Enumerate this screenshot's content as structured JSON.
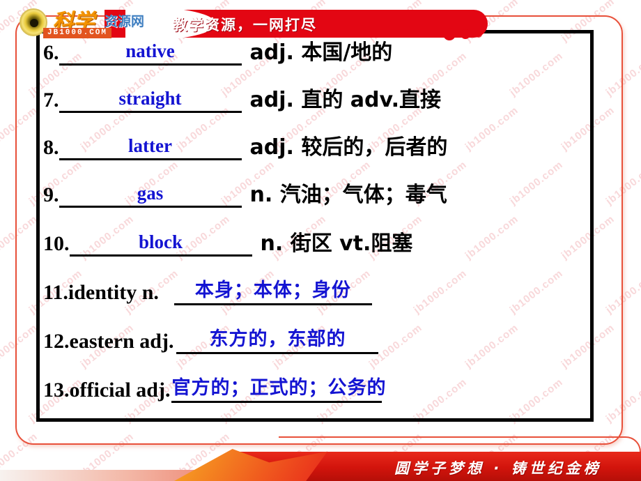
{
  "header": {
    "logo_cn": "科学",
    "logo_sub": "资源网",
    "site_url": "JB1000.COM",
    "slogan": "教学资源，一网打尽",
    "seal_name": "site-seal"
  },
  "footer": {
    "slogan": "圆学子梦想 · 铸世纪金榜"
  },
  "colors": {
    "brand_red": "#e30613",
    "frame_red": "#e8503a",
    "answer_blue": "#1414d2",
    "text_black": "#000000",
    "watermark_pink": "#f3b9bd"
  },
  "watermark": {
    "text": "jb1000.com"
  },
  "vocabulary": [
    {
      "number": "6.",
      "answer": "native",
      "answer_lang": "en",
      "definition": "adj. 本国/地的",
      "pos": "adj.",
      "meaning": "本国/地的",
      "style": "blank-first"
    },
    {
      "number": "7.",
      "answer": "straight",
      "answer_lang": "en",
      "definition": "adj. 直的 adv.直接",
      "pos": "adj.",
      "meaning": "直的 adv.直接",
      "style": "blank-first"
    },
    {
      "number": "8.",
      "answer": "latter",
      "answer_lang": "en",
      "definition": "adj. 较后的，后者的",
      "pos": "adj.",
      "meaning": "较后的，后者的",
      "style": "blank-first"
    },
    {
      "number": "9.",
      "answer": "gas",
      "answer_lang": "en",
      "definition": "n. 汽油；气体；毒气",
      "pos": "n.",
      "meaning": "汽油；气体；毒气",
      "style": "blank-first"
    },
    {
      "number": "10.",
      "answer": "block",
      "answer_lang": "en",
      "definition": "n. 街区 vt.阻塞",
      "pos": "n.",
      "meaning": "街区 vt.阻塞",
      "style": "blank-first"
    },
    {
      "number": "11.",
      "headword": "identity n.",
      "answer": "本身；本体；身份",
      "answer_lang": "cn",
      "style": "word-first"
    },
    {
      "number": "12.",
      "headword": "eastern adj.",
      "answer": "东方的，东部的",
      "answer_lang": "cn",
      "style": "word-first"
    },
    {
      "number": "13.",
      "headword": "official adj.",
      "answer": "官方的；正式的；公务的",
      "answer_lang": "cn",
      "style": "word-first"
    }
  ]
}
